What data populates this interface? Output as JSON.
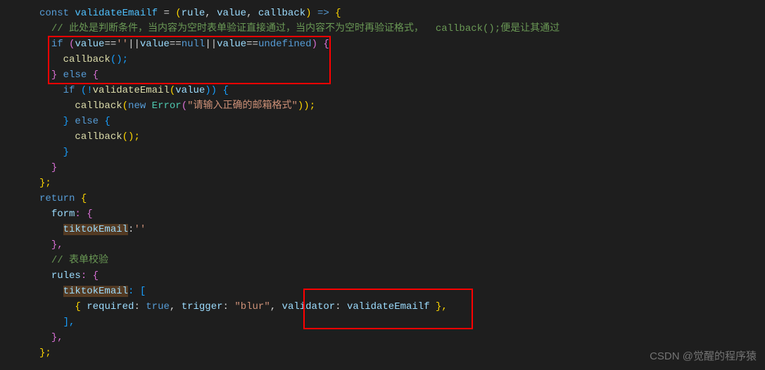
{
  "code": {
    "line1_const": "const",
    "line1_name": " validateEmailf ",
    "line1_eq": "= ",
    "line1_paren_open": "(",
    "line1_p1": "rule",
    "line1_comma1": ", ",
    "line1_p2": "value",
    "line1_comma2": ", ",
    "line1_p3": "callback",
    "line1_paren_close": ") ",
    "line1_arrow": "=>",
    "line1_brace": " {",
    "line2_comment": "// 此处是判断条件，当内容为空时表单验证直接通过，当内容不为空时再验证格式，  callback();便是让其通过",
    "line3_if": "if",
    "line3_open": " (",
    "line3_v1": "value",
    "line3_op1": "==",
    "line3_s1": "''",
    "line3_or1": "||",
    "line3_v2": "value",
    "line3_op2": "==",
    "line3_null": "null",
    "line3_or2": "||",
    "line3_v3": "value",
    "line3_op3": "==",
    "line3_undef": "undefined",
    "line3_close": ") {",
    "line4_cb": "callback",
    "line4_p": "();",
    "line5_close": "} ",
    "line5_else": "else",
    "line5_brace": " {",
    "line6_if": "if",
    "line6_open": " (!",
    "line6_fn": "validateEmail",
    "line6_popen": "(",
    "line6_val": "value",
    "line6_close": ")) {",
    "line7_cb": "callback",
    "line7_popen": "(",
    "line7_new": "new",
    "line7_sp": " ",
    "line7_err": "Error",
    "line7_p2open": "(",
    "line7_str": "\"请输入正确的邮箱格式\"",
    "line7_close": "));",
    "line8_close": "} ",
    "line8_else": "else",
    "line8_brace": " {",
    "line9_cb": "callback",
    "line9_p": "();",
    "line10_close": "}",
    "line11_close": "}",
    "line12_close": "};",
    "line13_return": "return",
    "line13_brace": " {",
    "line14_form": "form",
    "line14_c": ": {",
    "line15_te": "tiktokEmail",
    "line15_c": ":",
    "line15_s": "''",
    "line16_close": "},",
    "line17_comment": "// 表单校验",
    "line18_rules": "rules",
    "line18_c": ": {",
    "line19_te": "tiktokEmail",
    "line19_c": ": [",
    "line20_open": "{ ",
    "line20_req": "required",
    "line20_c1": ": ",
    "line20_true": "true",
    "line20_c2": ", ",
    "line20_trig": "trigger",
    "line20_c3": ": ",
    "line20_blur": "\"blur\"",
    "line20_c4": ", ",
    "line20_val": "validator",
    "line20_c5": ": ",
    "line20_vef": "validateEmailf",
    "line20_close": " },",
    "line21_close": "],",
    "line22_close": "},",
    "line23_close": "};"
  },
  "watermark": "CSDN @觉醒的程序猿"
}
